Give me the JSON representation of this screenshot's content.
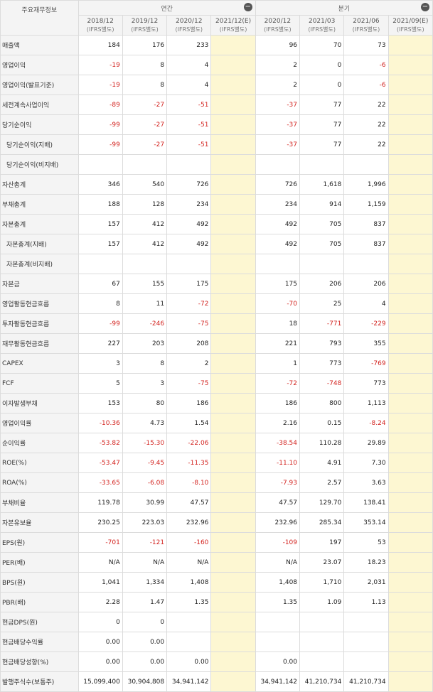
{
  "header": {
    "title": "주요재무정보",
    "group_annual": "연간",
    "group_quarter": "분기",
    "collapse_annual": "−",
    "collapse_quarter": "−",
    "periods": [
      {
        "period": "2018/12",
        "std": "(IFRS별도)"
      },
      {
        "period": "2019/12",
        "std": "(IFRS별도)"
      },
      {
        "period": "2020/12",
        "std": "(IFRS별도)"
      },
      {
        "period": "2021/12(E)",
        "std": "(IFRS별도)"
      },
      {
        "period": "2020/12",
        "std": "(IFRS별도)"
      },
      {
        "period": "2021/03",
        "std": "(IFRS별도)"
      },
      {
        "period": "2021/06",
        "std": "(IFRS별도)"
      },
      {
        "period": "2021/09(E)",
        "std": "(IFRS별도)"
      }
    ]
  },
  "rows": [
    {
      "label": "매출액",
      "values": [
        "184",
        "176",
        "233",
        "",
        "96",
        "70",
        "73",
        ""
      ]
    },
    {
      "label": "영업이익",
      "values": [
        "-19",
        "8",
        "4",
        "",
        "2",
        "0",
        "-6",
        ""
      ]
    },
    {
      "label": "영업이익(발표기준)",
      "values": [
        "-19",
        "8",
        "4",
        "",
        "2",
        "0",
        "-6",
        ""
      ]
    },
    {
      "label": "세전계속사업이익",
      "values": [
        "-89",
        "-27",
        "-51",
        "",
        "-37",
        "77",
        "22",
        ""
      ]
    },
    {
      "label": "당기순이익",
      "values": [
        "-99",
        "-27",
        "-51",
        "",
        "-37",
        "77",
        "22",
        ""
      ]
    },
    {
      "label": "당기순이익(지배)",
      "values": [
        "-99",
        "-27",
        "-51",
        "",
        "-37",
        "77",
        "22",
        ""
      ]
    },
    {
      "label": "당기순이익(비지배)",
      "values": [
        "",
        "",
        "",
        "",
        "",
        "",
        "",
        ""
      ]
    },
    {
      "label": "자산총계",
      "values": [
        "346",
        "540",
        "726",
        "",
        "726",
        "1,618",
        "1,996",
        ""
      ]
    },
    {
      "label": "부채총계",
      "values": [
        "188",
        "128",
        "234",
        "",
        "234",
        "914",
        "1,159",
        ""
      ]
    },
    {
      "label": "자본총계",
      "values": [
        "157",
        "412",
        "492",
        "",
        "492",
        "705",
        "837",
        ""
      ]
    },
    {
      "label": "자본총계(지배)",
      "values": [
        "157",
        "412",
        "492",
        "",
        "492",
        "705",
        "837",
        ""
      ]
    },
    {
      "label": "자본총계(비지배)",
      "values": [
        "",
        "",
        "",
        "",
        "",
        "",
        "",
        ""
      ]
    },
    {
      "label": "자본금",
      "values": [
        "67",
        "155",
        "175",
        "",
        "175",
        "206",
        "206",
        ""
      ]
    },
    {
      "label": "영업활동현금흐름",
      "values": [
        "8",
        "11",
        "-72",
        "",
        "-70",
        "25",
        "4",
        ""
      ]
    },
    {
      "label": "투자활동현금흐름",
      "values": [
        "-99",
        "-246",
        "-75",
        "",
        "18",
        "-771",
        "-229",
        ""
      ]
    },
    {
      "label": "재무활동현금흐름",
      "values": [
        "227",
        "203",
        "208",
        "",
        "221",
        "793",
        "355",
        ""
      ]
    },
    {
      "label": "CAPEX",
      "values": [
        "3",
        "8",
        "2",
        "",
        "1",
        "773",
        "-769",
        ""
      ]
    },
    {
      "label": "FCF",
      "values": [
        "5",
        "3",
        "-75",
        "",
        "-72",
        "-748",
        "773",
        ""
      ]
    },
    {
      "label": "이자발생부채",
      "values": [
        "153",
        "80",
        "186",
        "",
        "186",
        "800",
        "1,113",
        ""
      ]
    },
    {
      "label": "영업이익률",
      "values": [
        "-10.36",
        "4.73",
        "1.54",
        "",
        "2.16",
        "0.15",
        "-8.24",
        ""
      ]
    },
    {
      "label": "순이익률",
      "values": [
        "-53.82",
        "-15.30",
        "-22.06",
        "",
        "-38.54",
        "110.28",
        "29.89",
        ""
      ]
    },
    {
      "label": "ROE(%)",
      "values": [
        "-53.47",
        "-9.45",
        "-11.35",
        "",
        "-11.10",
        "4.91",
        "7.30",
        ""
      ]
    },
    {
      "label": "ROA(%)",
      "values": [
        "-33.65",
        "-6.08",
        "-8.10",
        "",
        "-7.93",
        "2.57",
        "3.63",
        ""
      ]
    },
    {
      "label": "부채비율",
      "values": [
        "119.78",
        "30.99",
        "47.57",
        "",
        "47.57",
        "129.70",
        "138.41",
        ""
      ]
    },
    {
      "label": "자본유보율",
      "values": [
        "230.25",
        "223.03",
        "232.96",
        "",
        "232.96",
        "285.34",
        "353.14",
        ""
      ]
    },
    {
      "label": "EPS(원)",
      "values": [
        "-701",
        "-121",
        "-160",
        "",
        "-109",
        "197",
        "53",
        ""
      ]
    },
    {
      "label": "PER(배)",
      "values": [
        "N/A",
        "N/A",
        "N/A",
        "",
        "N/A",
        "23.07",
        "18.23",
        ""
      ]
    },
    {
      "label": "BPS(원)",
      "values": [
        "1,041",
        "1,334",
        "1,408",
        "",
        "1,408",
        "1,710",
        "2,031",
        ""
      ]
    },
    {
      "label": "PBR(배)",
      "values": [
        "2.28",
        "1.47",
        "1.35",
        "",
        "1.35",
        "1.09",
        "1.13",
        ""
      ]
    },
    {
      "label": "현금DPS(원)",
      "values": [
        "0",
        "0",
        "",
        "",
        "",
        "",
        "",
        ""
      ]
    },
    {
      "label": "현금배당수익률",
      "values": [
        "0.00",
        "0.00",
        "",
        "",
        "",
        "",
        "",
        ""
      ]
    },
    {
      "label": "현금배당성향(%)",
      "values": [
        "0.00",
        "0.00",
        "0.00",
        "",
        "0.00",
        "",
        "",
        ""
      ]
    },
    {
      "label": "발행주식수(보통주)",
      "values": [
        "15,099,400",
        "30,904,808",
        "34,941,142",
        "",
        "34,941,142",
        "41,210,734",
        "41,210,734",
        ""
      ]
    }
  ]
}
